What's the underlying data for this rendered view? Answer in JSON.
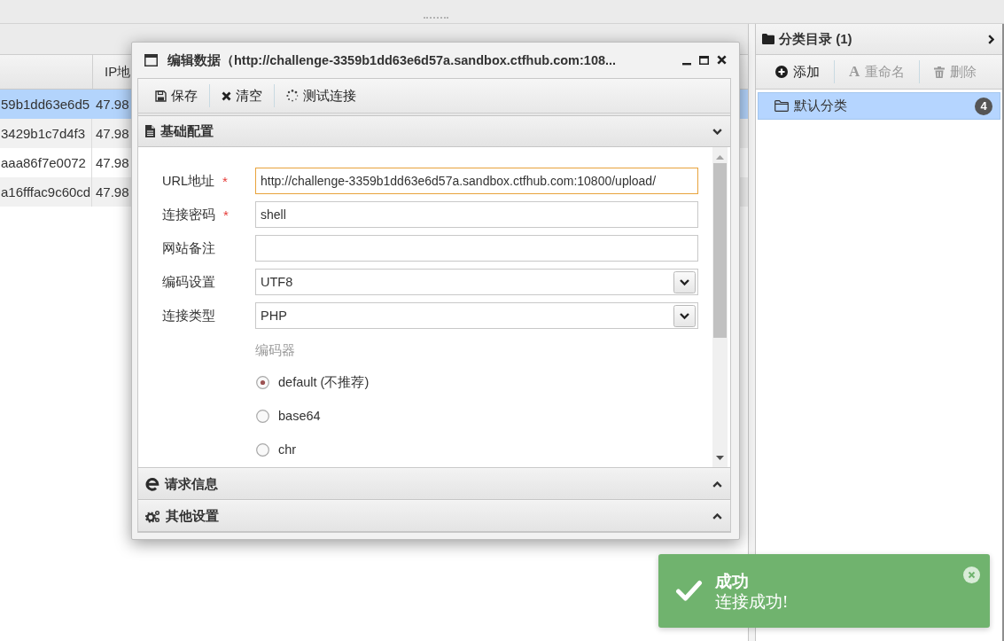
{
  "table": {
    "column_2_heading": "IP地",
    "rows": [
      {
        "column_1": "59b1dd63e6d5",
        "column_2": "47.98",
        "selected": true
      },
      {
        "column_1": "3429b1c7d4f3",
        "column_2": "47.98",
        "selected": false
      },
      {
        "column_1": "aaa86f7e0072",
        "column_2": "47.98",
        "selected": false
      },
      {
        "column_1": "a16fffac9c60cd",
        "column_2": "47.98",
        "selected": false
      }
    ]
  },
  "dialog": {
    "title": "编辑数据（http://challenge-3359b1dd63e6d57a.sandbox.ctfhub.com:108...",
    "toolbar": [
      {
        "label": "保存",
        "kind": "save"
      },
      {
        "label": "清空",
        "kind": "clear"
      },
      {
        "label": "测试连接",
        "kind": "test"
      }
    ],
    "sections": [
      {
        "title": "基础配置",
        "kind": "basic",
        "expanded": true,
        "fields": [
          {
            "label": "URL地址",
            "required_mark": "*",
            "kind": "text",
            "value": "http://challenge-3359b1dd63e6d57a.sandbox.ctfhub.com:10800/upload/",
            "focused": true
          },
          {
            "label": "连接密码",
            "required_mark": "*",
            "kind": "text",
            "value": "shell",
            "focused": false
          },
          {
            "label": "网站备注",
            "kind": "text",
            "focused": false
          },
          {
            "label": "编码设置",
            "kind": "select",
            "value": "UTF8"
          },
          {
            "label": "连接类型",
            "kind": "select",
            "value": "PHP"
          }
        ],
        "encoder": {
          "label": "编码器",
          "options": [
            {
              "label": "default (不推荐)",
              "selected": true
            },
            {
              "label": "base64",
              "selected": false
            },
            {
              "label": "chr",
              "selected": false
            }
          ]
        }
      },
      {
        "title": "请求信息",
        "kind": "request",
        "expanded": false
      },
      {
        "title": "其他设置",
        "kind": "other",
        "expanded": false
      }
    ]
  },
  "category_panel": {
    "title": "分类目录 (1)",
    "toolbar": [
      {
        "label": "添加",
        "kind": "add",
        "disabled": false
      },
      {
        "label": "重命名",
        "kind": "rename",
        "glyph": "A",
        "disabled": true
      },
      {
        "label": "删除",
        "kind": "delete",
        "disabled": true
      }
    ],
    "items": [
      {
        "label": "默认分类",
        "count": "4",
        "selected": true
      }
    ]
  },
  "toast": {
    "kind": "success",
    "title": "成功",
    "message": "连接成功!"
  }
}
